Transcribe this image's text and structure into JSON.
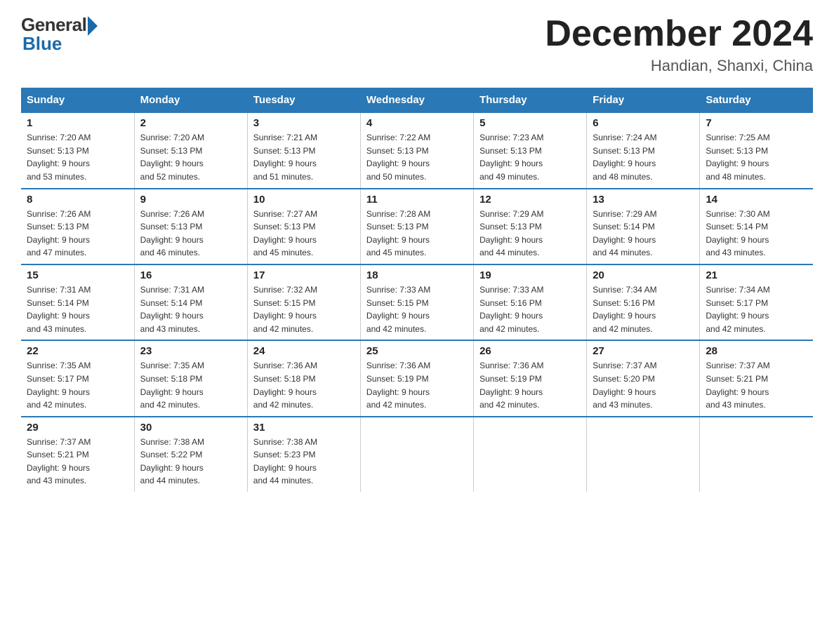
{
  "header": {
    "logo_general": "General",
    "logo_blue": "Blue",
    "month_title": "December 2024",
    "location": "Handian, Shanxi, China"
  },
  "days_of_week": [
    "Sunday",
    "Monday",
    "Tuesday",
    "Wednesday",
    "Thursday",
    "Friday",
    "Saturday"
  ],
  "weeks": [
    [
      {
        "day": "1",
        "sunrise": "7:20 AM",
        "sunset": "5:13 PM",
        "daylight": "9 hours and 53 minutes."
      },
      {
        "day": "2",
        "sunrise": "7:20 AM",
        "sunset": "5:13 PM",
        "daylight": "9 hours and 52 minutes."
      },
      {
        "day": "3",
        "sunrise": "7:21 AM",
        "sunset": "5:13 PM",
        "daylight": "9 hours and 51 minutes."
      },
      {
        "day": "4",
        "sunrise": "7:22 AM",
        "sunset": "5:13 PM",
        "daylight": "9 hours and 50 minutes."
      },
      {
        "day": "5",
        "sunrise": "7:23 AM",
        "sunset": "5:13 PM",
        "daylight": "9 hours and 49 minutes."
      },
      {
        "day": "6",
        "sunrise": "7:24 AM",
        "sunset": "5:13 PM",
        "daylight": "9 hours and 48 minutes."
      },
      {
        "day": "7",
        "sunrise": "7:25 AM",
        "sunset": "5:13 PM",
        "daylight": "9 hours and 48 minutes."
      }
    ],
    [
      {
        "day": "8",
        "sunrise": "7:26 AM",
        "sunset": "5:13 PM",
        "daylight": "9 hours and 47 minutes."
      },
      {
        "day": "9",
        "sunrise": "7:26 AM",
        "sunset": "5:13 PM",
        "daylight": "9 hours and 46 minutes."
      },
      {
        "day": "10",
        "sunrise": "7:27 AM",
        "sunset": "5:13 PM",
        "daylight": "9 hours and 45 minutes."
      },
      {
        "day": "11",
        "sunrise": "7:28 AM",
        "sunset": "5:13 PM",
        "daylight": "9 hours and 45 minutes."
      },
      {
        "day": "12",
        "sunrise": "7:29 AM",
        "sunset": "5:13 PM",
        "daylight": "9 hours and 44 minutes."
      },
      {
        "day": "13",
        "sunrise": "7:29 AM",
        "sunset": "5:14 PM",
        "daylight": "9 hours and 44 minutes."
      },
      {
        "day": "14",
        "sunrise": "7:30 AM",
        "sunset": "5:14 PM",
        "daylight": "9 hours and 43 minutes."
      }
    ],
    [
      {
        "day": "15",
        "sunrise": "7:31 AM",
        "sunset": "5:14 PM",
        "daylight": "9 hours and 43 minutes."
      },
      {
        "day": "16",
        "sunrise": "7:31 AM",
        "sunset": "5:14 PM",
        "daylight": "9 hours and 43 minutes."
      },
      {
        "day": "17",
        "sunrise": "7:32 AM",
        "sunset": "5:15 PM",
        "daylight": "9 hours and 42 minutes."
      },
      {
        "day": "18",
        "sunrise": "7:33 AM",
        "sunset": "5:15 PM",
        "daylight": "9 hours and 42 minutes."
      },
      {
        "day": "19",
        "sunrise": "7:33 AM",
        "sunset": "5:16 PM",
        "daylight": "9 hours and 42 minutes."
      },
      {
        "day": "20",
        "sunrise": "7:34 AM",
        "sunset": "5:16 PM",
        "daylight": "9 hours and 42 minutes."
      },
      {
        "day": "21",
        "sunrise": "7:34 AM",
        "sunset": "5:17 PM",
        "daylight": "9 hours and 42 minutes."
      }
    ],
    [
      {
        "day": "22",
        "sunrise": "7:35 AM",
        "sunset": "5:17 PM",
        "daylight": "9 hours and 42 minutes."
      },
      {
        "day": "23",
        "sunrise": "7:35 AM",
        "sunset": "5:18 PM",
        "daylight": "9 hours and 42 minutes."
      },
      {
        "day": "24",
        "sunrise": "7:36 AM",
        "sunset": "5:18 PM",
        "daylight": "9 hours and 42 minutes."
      },
      {
        "day": "25",
        "sunrise": "7:36 AM",
        "sunset": "5:19 PM",
        "daylight": "9 hours and 42 minutes."
      },
      {
        "day": "26",
        "sunrise": "7:36 AM",
        "sunset": "5:19 PM",
        "daylight": "9 hours and 42 minutes."
      },
      {
        "day": "27",
        "sunrise": "7:37 AM",
        "sunset": "5:20 PM",
        "daylight": "9 hours and 43 minutes."
      },
      {
        "day": "28",
        "sunrise": "7:37 AM",
        "sunset": "5:21 PM",
        "daylight": "9 hours and 43 minutes."
      }
    ],
    [
      {
        "day": "29",
        "sunrise": "7:37 AM",
        "sunset": "5:21 PM",
        "daylight": "9 hours and 43 minutes."
      },
      {
        "day": "30",
        "sunrise": "7:38 AM",
        "sunset": "5:22 PM",
        "daylight": "9 hours and 44 minutes."
      },
      {
        "day": "31",
        "sunrise": "7:38 AM",
        "sunset": "5:23 PM",
        "daylight": "9 hours and 44 minutes."
      },
      {
        "day": "",
        "sunrise": "",
        "sunset": "",
        "daylight": ""
      },
      {
        "day": "",
        "sunrise": "",
        "sunset": "",
        "daylight": ""
      },
      {
        "day": "",
        "sunrise": "",
        "sunset": "",
        "daylight": ""
      },
      {
        "day": "",
        "sunrise": "",
        "sunset": "",
        "daylight": ""
      }
    ]
  ],
  "labels": {
    "sunrise_prefix": "Sunrise: ",
    "sunset_prefix": "Sunset: ",
    "daylight_prefix": "Daylight: "
  }
}
